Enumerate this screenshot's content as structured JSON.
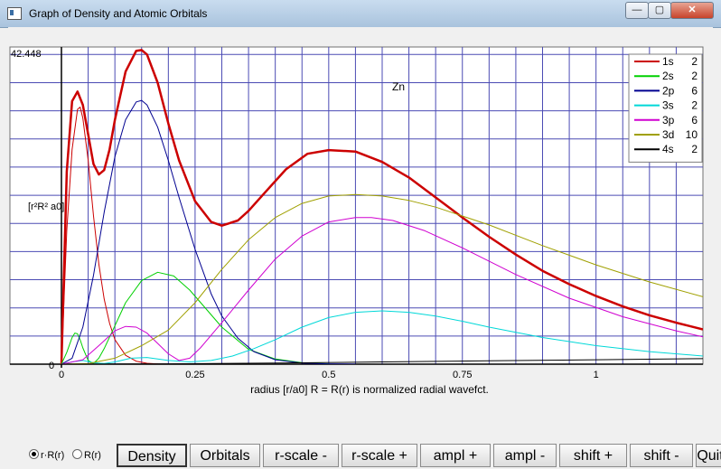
{
  "window": {
    "title": "Graph of Density and Atomic Orbitals",
    "min_label": "—",
    "max_label": "▢",
    "close_label": "✕"
  },
  "chart_data": {
    "type": "line",
    "element_label": "Zn",
    "ylabel": "[r²R² a0]",
    "y_top_label": "42.448",
    "y_zero_label": "0",
    "xlabel": "radius [r/a0]    R = R(r) is normalized radial wavefct.",
    "xlim": [
      0,
      1.2
    ],
    "ylim": [
      0,
      42.448
    ],
    "x_ticks": [
      {
        "v": 0,
        "label": "0"
      },
      {
        "v": 0.25,
        "label": "0.25"
      },
      {
        "v": 0.5,
        "label": "0.5"
      },
      {
        "v": 0.75,
        "label": "0.75"
      },
      {
        "v": 1,
        "label": "1"
      }
    ],
    "legend": [
      {
        "orbital": "1s",
        "electrons": "2",
        "color": "#cc0000"
      },
      {
        "orbital": "2s",
        "electrons": "2",
        "color": "#00d000"
      },
      {
        "orbital": "2p",
        "electrons": "6",
        "color": "#000090"
      },
      {
        "orbital": "3s",
        "electrons": "2",
        "color": "#00d8d8"
      },
      {
        "orbital": "3p",
        "electrons": "6",
        "color": "#d000d0"
      },
      {
        "orbital": "3d",
        "electrons": "10",
        "color": "#a0a000"
      },
      {
        "orbital": "4s",
        "electrons": "2",
        "color": "#000000"
      }
    ],
    "series": [
      {
        "color": "#cc0000",
        "width": 2.5,
        "x": [
          0,
          0.01,
          0.02,
          0.03,
          0.04,
          0.05,
          0.06,
          0.07,
          0.08,
          0.09,
          0.1,
          0.12,
          0.14,
          0.15,
          0.16,
          0.18,
          0.2,
          0.22,
          0.25,
          0.28,
          0.3,
          0.33,
          0.35,
          0.38,
          0.42,
          0.46,
          0.5,
          0.55,
          0.6,
          0.65,
          0.7,
          0.75,
          0.8,
          0.85,
          0.9,
          0.95,
          1.0,
          1.05,
          1.1,
          1.15,
          1.2
        ],
        "y": [
          0,
          26,
          35.5,
          36.8,
          35,
          31,
          27,
          25.6,
          26.2,
          29,
          33,
          39.5,
          42.3,
          42.4,
          41.8,
          38,
          32.5,
          27.5,
          22,
          19.2,
          18.7,
          19.4,
          20.7,
          23.1,
          26.3,
          28.4,
          28.9,
          28.7,
          27.3,
          25.2,
          22.5,
          19.8,
          17.2,
          14.8,
          12.6,
          10.8,
          9.2,
          7.8,
          6.6,
          5.6,
          4.7
        ]
      },
      {
        "color": "#cc0000",
        "width": 1,
        "x": [
          0,
          0.01,
          0.02,
          0.03,
          0.035,
          0.04,
          0.05,
          0.06,
          0.07,
          0.08,
          0.09,
          0.1,
          0.12,
          0.14,
          0.16,
          0.18,
          0.2
        ],
        "y": [
          0,
          18,
          29,
          34.4,
          34.7,
          33.2,
          27.5,
          20,
          13.5,
          8.8,
          5.5,
          3.3,
          1.2,
          0.4,
          0.12,
          0.03,
          0
        ]
      },
      {
        "color": "#00d000",
        "width": 1,
        "x": [
          0,
          0.01,
          0.02,
          0.025,
          0.03,
          0.035,
          0.04,
          0.05,
          0.06,
          0.07,
          0.08,
          0.1,
          0.12,
          0.15,
          0.18,
          0.21,
          0.24,
          0.27,
          0.3,
          0.35,
          0.4,
          0.45,
          0.5
        ],
        "y": [
          0,
          1.6,
          3.6,
          4.2,
          4.1,
          3.3,
          2.2,
          0.5,
          0.1,
          0.8,
          2.1,
          5.2,
          8.3,
          11.3,
          12.4,
          11.9,
          10,
          7.5,
          5,
          2,
          0.7,
          0.2,
          0.05
        ]
      },
      {
        "color": "#000090",
        "width": 1,
        "x": [
          0,
          0.02,
          0.04,
          0.06,
          0.08,
          0.1,
          0.12,
          0.14,
          0.15,
          0.16,
          0.18,
          0.2,
          0.22,
          0.25,
          0.28,
          0.3,
          0.33,
          0.36,
          0.4,
          0.45,
          0.5,
          0.55
        ],
        "y": [
          0,
          0.8,
          5,
          12,
          20.5,
          28,
          33,
          35.4,
          35.6,
          35,
          32,
          27.5,
          22.5,
          15.5,
          9.5,
          6.5,
          3.5,
          1.7,
          0.6,
          0.15,
          0.04,
          0
        ]
      },
      {
        "color": "#00d8d8",
        "width": 1,
        "x": [
          0,
          0.02,
          0.04,
          0.06,
          0.08,
          0.1,
          0.13,
          0.16,
          0.2,
          0.24,
          0.28,
          0.32,
          0.36,
          0.4,
          0.45,
          0.5,
          0.55,
          0.6,
          0.65,
          0.7,
          0.75,
          0.8,
          0.9,
          1.0,
          1.1,
          1.2
        ],
        "y": [
          0,
          0.3,
          0.5,
          0.2,
          0.1,
          0.3,
          0.8,
          0.9,
          0.5,
          0.3,
          0.5,
          1.1,
          2.1,
          3.3,
          5,
          6.3,
          7,
          7.2,
          7,
          6.5,
          5.8,
          5,
          3.6,
          2.5,
          1.7,
          1.1
        ]
      },
      {
        "color": "#d000d0",
        "width": 1,
        "x": [
          0,
          0.04,
          0.07,
          0.1,
          0.12,
          0.14,
          0.16,
          0.18,
          0.2,
          0.22,
          0.24,
          0.26,
          0.3,
          0.35,
          0.4,
          0.45,
          0.5,
          0.55,
          0.58,
          0.62,
          0.68,
          0.75,
          0.85,
          0.95,
          1.05,
          1.15,
          1.2
        ],
        "y": [
          0,
          0.6,
          2.5,
          4.5,
          5.1,
          5,
          4.2,
          2.8,
          1.4,
          0.5,
          0.8,
          2.2,
          5.6,
          10,
          14.2,
          17.3,
          19.2,
          19.8,
          19.8,
          19.4,
          18,
          15.7,
          12.1,
          8.9,
          6.4,
          4.5,
          3.7
        ]
      },
      {
        "color": "#a0a000",
        "width": 1,
        "x": [
          0,
          0.05,
          0.1,
          0.15,
          0.2,
          0.25,
          0.3,
          0.35,
          0.4,
          0.45,
          0.5,
          0.55,
          0.6,
          0.65,
          0.7,
          0.8,
          0.9,
          1.0,
          1.1,
          1.2
        ],
        "y": [
          0,
          0.1,
          0.8,
          2.5,
          4.6,
          8.3,
          12.8,
          16.8,
          19.8,
          21.7,
          22.7,
          22.9,
          22.7,
          22.1,
          21.2,
          18.8,
          16,
          13.4,
          11.1,
          9.1
        ]
      },
      {
        "color": "#000000",
        "width": 1,
        "x": [
          0,
          0.2,
          0.4,
          0.6,
          0.8,
          1.0,
          1.2
        ],
        "y": [
          0,
          0.05,
          0.15,
          0.3,
          0.45,
          0.6,
          0.75
        ]
      }
    ]
  },
  "controls": {
    "radio1": "r·R(r)",
    "radio2": "R(r)",
    "buttons": [
      "Density",
      "Orbitals",
      "r-scale -",
      "r-scale +",
      "ampl +",
      "ampl -",
      "shift +",
      "shift -",
      "Quit"
    ]
  }
}
